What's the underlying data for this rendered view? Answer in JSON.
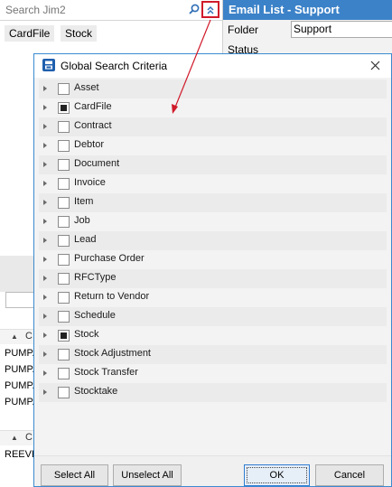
{
  "search": {
    "placeholder": "Search Jim2"
  },
  "chips": [
    "CardFile",
    "Stock"
  ],
  "left_panel": {
    "section1_letter": "C",
    "rows1": [
      "PUMP.",
      "PUMP.",
      "PUMP.",
      "PUMP."
    ],
    "section2_letter": "C",
    "rows2": [
      "REEVE"
    ]
  },
  "right_panel": {
    "title": "Email List - Support",
    "folder_label": "Folder",
    "folder_value": "Support",
    "status_label": "Status"
  },
  "dialog": {
    "title": "Global Search Criteria",
    "items": [
      {
        "label": "Asset",
        "checked": false
      },
      {
        "label": "CardFile",
        "checked": true
      },
      {
        "label": "Contract",
        "checked": false
      },
      {
        "label": "Debtor",
        "checked": false
      },
      {
        "label": "Document",
        "checked": false
      },
      {
        "label": "Invoice",
        "checked": false
      },
      {
        "label": "Item",
        "checked": false
      },
      {
        "label": "Job",
        "checked": false
      },
      {
        "label": "Lead",
        "checked": false
      },
      {
        "label": "Purchase Order",
        "checked": false
      },
      {
        "label": "RFCType",
        "checked": false
      },
      {
        "label": "Return to Vendor",
        "checked": false
      },
      {
        "label": "Schedule",
        "checked": false
      },
      {
        "label": "Stock",
        "checked": true
      },
      {
        "label": "Stock Adjustment",
        "checked": false
      },
      {
        "label": "Stock Transfer",
        "checked": false
      },
      {
        "label": "Stocktake",
        "checked": false
      }
    ],
    "buttons": {
      "select_all": "Select All",
      "unselect_all": "Unselect All",
      "ok": "OK",
      "cancel": "Cancel"
    }
  },
  "colors": {
    "accent_blue": "#3c82c8",
    "annotation_red": "#d01a2a"
  }
}
